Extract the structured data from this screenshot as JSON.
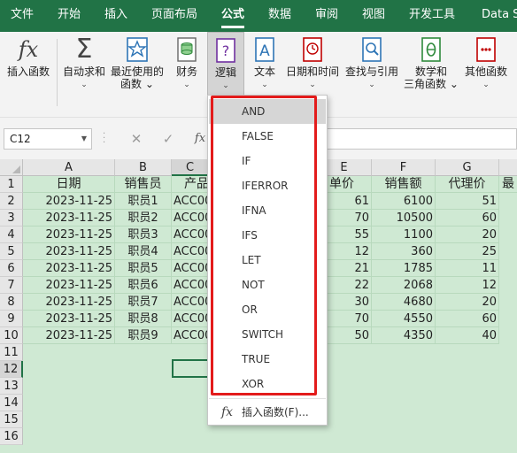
{
  "menu": {
    "tabs": [
      "文件",
      "开始",
      "插入",
      "页面布局",
      "公式",
      "数据",
      "审阅",
      "视图",
      "开发工具",
      "Data S"
    ],
    "active_index": 4
  },
  "ribbon": {
    "insert_function": "插入函数",
    "autosum": "自动求和",
    "recent_line1": "最近使用的",
    "recent_line2": "函数",
    "financial": "财务",
    "logical": "逻辑",
    "text": "文本",
    "datetime": "日期和时间",
    "lookup": "查找与引用",
    "math_line1": "数学和",
    "math_line2": "三角函数",
    "more": "其他函数",
    "fx_glyph": "fx",
    "sigma_glyph": "Σ"
  },
  "formula_bar": {
    "name_box": "C12",
    "cancel": "✕",
    "enter": "✓",
    "fx": "fx",
    "content": ""
  },
  "columns": [
    "A",
    "B",
    "C",
    "D",
    "E",
    "F",
    "G"
  ],
  "rows": [
    "1",
    "2",
    "3",
    "4",
    "5",
    "6",
    "7",
    "8",
    "9",
    "10",
    "11",
    "12",
    "13",
    "14",
    "15",
    "16"
  ],
  "header_row": {
    "A": "日期",
    "B": "销售员",
    "C": "产品",
    "E": "单价",
    "F": "销售额",
    "G": "代理价",
    "H": "最"
  },
  "data_rows": [
    {
      "date": "2023-11-25",
      "seller": "职员1",
      "product": "ACC00",
      "price": "61",
      "sales": "6100",
      "agent": "51"
    },
    {
      "date": "2023-11-25",
      "seller": "职员2",
      "product": "ACC00",
      "price": "70",
      "sales": "10500",
      "agent": "60"
    },
    {
      "date": "2023-11-25",
      "seller": "职员3",
      "product": "ACC00",
      "price": "55",
      "sales": "1100",
      "agent": "20"
    },
    {
      "date": "2023-11-25",
      "seller": "职员4",
      "product": "ACC00",
      "price": "12",
      "sales": "360",
      "agent": "25"
    },
    {
      "date": "2023-11-25",
      "seller": "职员5",
      "product": "ACC00",
      "price": "21",
      "sales": "1785",
      "agent": "11"
    },
    {
      "date": "2023-11-25",
      "seller": "职员6",
      "product": "ACC00",
      "price": "22",
      "sales": "2068",
      "agent": "12"
    },
    {
      "date": "2023-11-25",
      "seller": "职员7",
      "product": "ACC00",
      "price": "30",
      "sales": "4680",
      "agent": "20"
    },
    {
      "date": "2023-11-25",
      "seller": "职员8",
      "product": "ACC00",
      "price": "70",
      "sales": "4550",
      "agent": "60"
    },
    {
      "date": "2023-11-25",
      "seller": "职员9",
      "product": "ACC00",
      "price": "50",
      "sales": "4350",
      "agent": "40"
    }
  ],
  "dropdown": {
    "items": [
      "AND",
      "FALSE",
      "IF",
      "IFERROR",
      "IFNA",
      "IFS",
      "LET",
      "NOT",
      "OR",
      "SWITCH",
      "TRUE",
      "XOR"
    ],
    "highlighted_index": 0,
    "footer_label": "插入函数(F)...",
    "footer_icon": "fx"
  },
  "colors": {
    "menubar": "#217346",
    "sheet_bg": "#cfe9d3",
    "annotation": "#e31b1b"
  }
}
